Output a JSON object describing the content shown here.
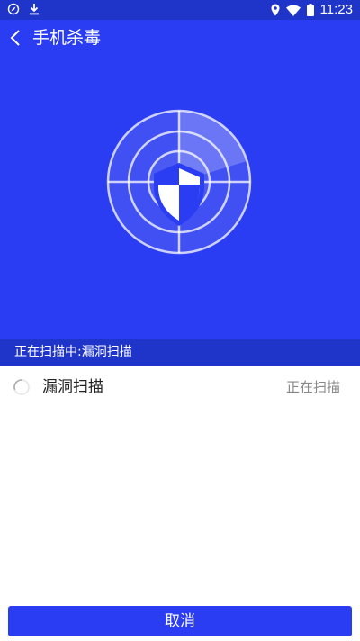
{
  "status_bar": {
    "time": "11:23",
    "left_icons": [
      "compass-icon",
      "download-icon"
    ],
    "right_icons": [
      "location-icon",
      "wifi-icon",
      "battery-icon"
    ]
  },
  "header": {
    "title": "手机杀毒",
    "back_icon": "chevron-left-icon"
  },
  "scan": {
    "progress_text": "正在扫描中:漏洞扫描",
    "radar_icon": "shield-radar-icon"
  },
  "scan_items": [
    {
      "label": "漏洞扫描",
      "status": "正在扫描"
    }
  ],
  "footer": {
    "cancel_label": "取消"
  },
  "colors": {
    "primary": "#2b3df2",
    "primary_dark": "#1f35c9",
    "text_dark": "#222222",
    "text_gray": "#888888"
  }
}
